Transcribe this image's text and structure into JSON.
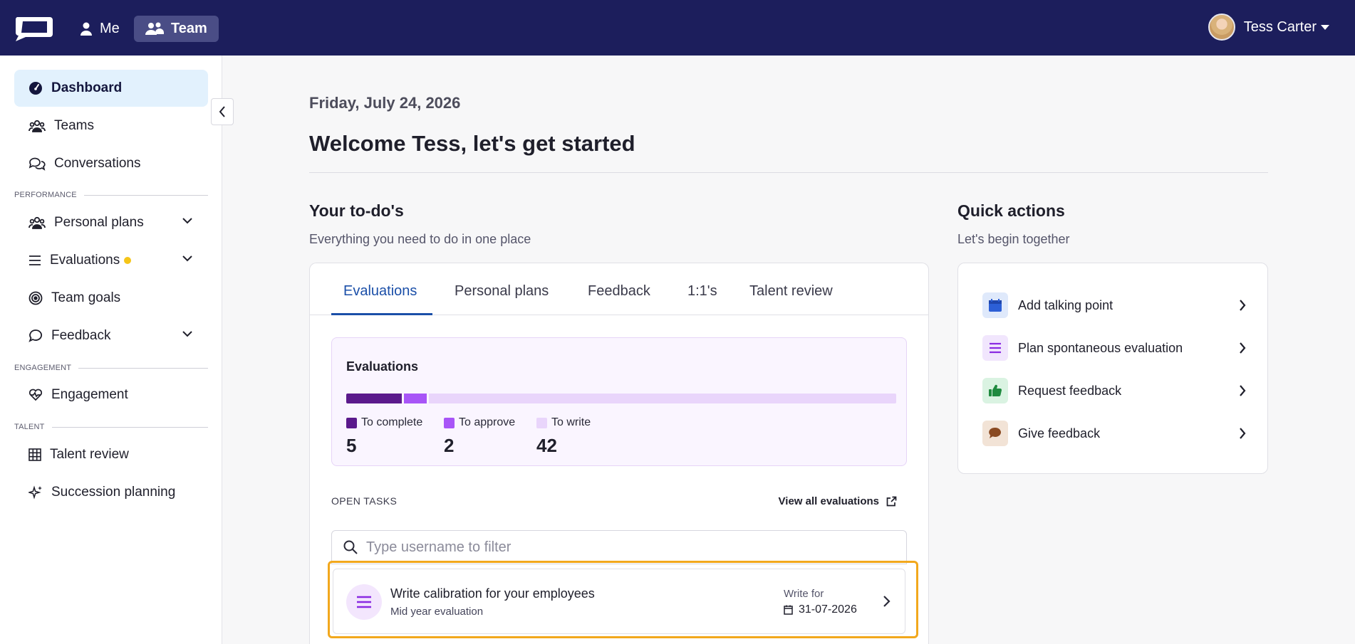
{
  "nav": {
    "me_label": "Me",
    "team_label": "Team",
    "user_name": "Tess Carter"
  },
  "sidebar": {
    "items": [
      {
        "label": "Dashboard"
      },
      {
        "label": "Teams"
      },
      {
        "label": "Conversations"
      },
      {
        "label": "Personal plans"
      },
      {
        "label": "Evaluations"
      },
      {
        "label": "Team goals"
      },
      {
        "label": "Feedback"
      },
      {
        "label": "Engagement"
      },
      {
        "label": "Talent review"
      },
      {
        "label": "Succession planning"
      }
    ],
    "sections": {
      "performance": "PERFORMANCE",
      "engagement": "ENGAGEMENT",
      "talent": "TALENT"
    }
  },
  "main": {
    "date": "Friday, July 24, 2026",
    "welcome": "Welcome Tess, let's get started",
    "todo": {
      "title": "Your to-do's",
      "subtitle": "Everything you need to do in one place",
      "tabs": [
        "Evaluations",
        "Personal plans",
        "Feedback",
        "1:1's",
        "Talent review"
      ],
      "evaluations": {
        "title": "Evaluations",
        "stats": [
          {
            "label": "To complete",
            "value": "5",
            "color": "#5b1a8c"
          },
          {
            "label": "To approve",
            "value": "2",
            "color": "#a855f7"
          },
          {
            "label": "To write",
            "value": "42",
            "color": "#e9d5fb"
          }
        ]
      },
      "open_tasks_label": "OPEN TASKS",
      "view_all_label": "View all evaluations",
      "search_placeholder": "Type username to filter",
      "task": {
        "title": "Write calibration for your employees",
        "subtitle": "Mid year evaluation",
        "write_for_label": "Write for",
        "due": "31-07-2026"
      }
    },
    "quick_actions": {
      "title": "Quick actions",
      "subtitle": "Let's begin together",
      "items": [
        {
          "label": "Add talking point",
          "icon": "calendar-icon"
        },
        {
          "label": "Plan spontaneous evaluation",
          "icon": "list-icon"
        },
        {
          "label": "Request feedback",
          "icon": "thumbs-up-icon"
        },
        {
          "label": "Give feedback",
          "icon": "chat-bubble-icon"
        }
      ]
    }
  }
}
